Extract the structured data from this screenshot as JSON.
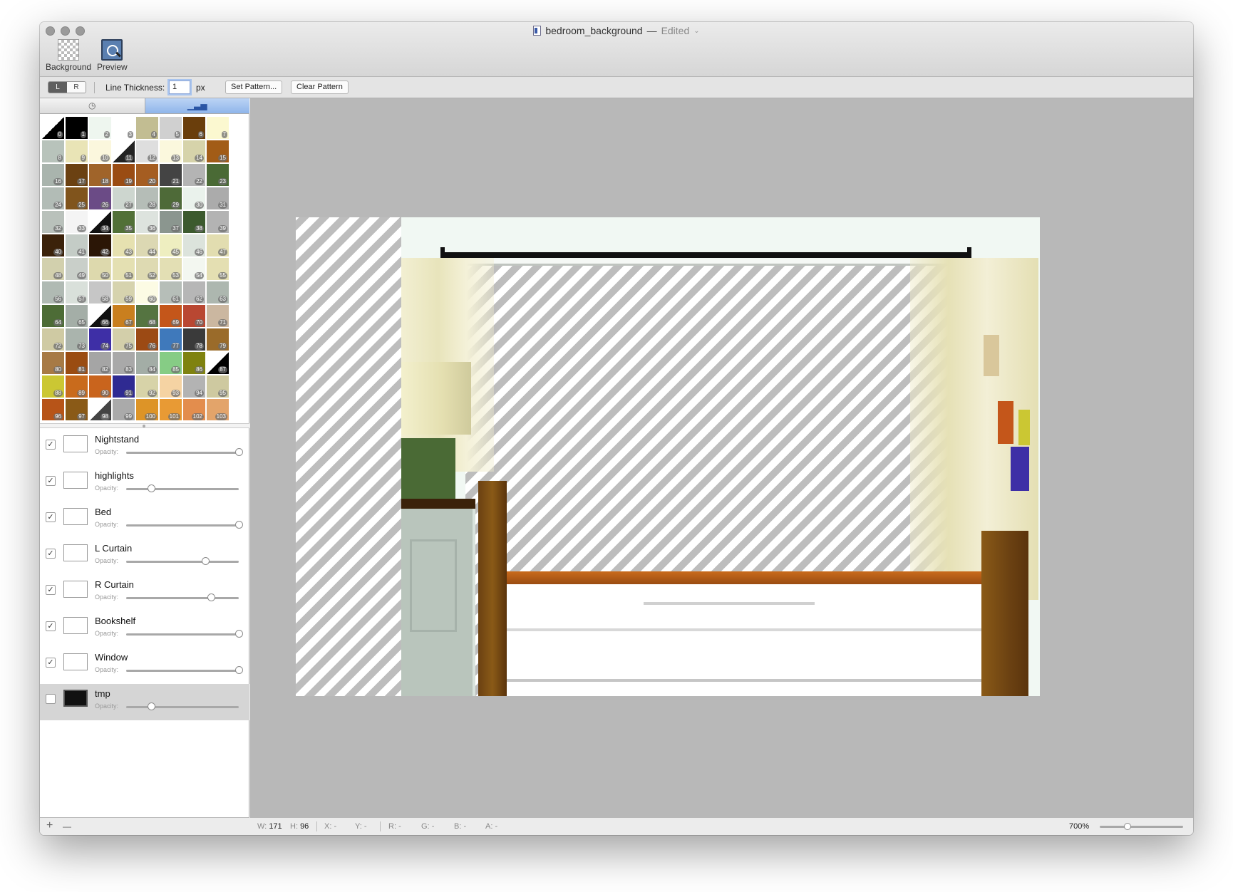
{
  "window": {
    "title": "bedroom_background",
    "title_separator": "—",
    "status": "Edited"
  },
  "toolbar": {
    "background_label": "Background",
    "preview_label": "Preview"
  },
  "options": {
    "left_button": "L",
    "right_button": "R",
    "line_thickness_label": "Line Thickness:",
    "line_thickness_value": "1",
    "line_thickness_unit": "px",
    "set_pattern_label": "Set Pattern...",
    "clear_pattern_label": "Clear Pattern"
  },
  "sidebar": {
    "tabs": [
      {
        "icon": "clock-icon",
        "label": "◷"
      },
      {
        "icon": "bar-chart-icon",
        "label": "▁▃▅"
      }
    ],
    "palette": [
      {
        "n": "0",
        "c": "split:#000000"
      },
      {
        "n": "1",
        "c": "#000000"
      },
      {
        "n": "2",
        "c": "#eef6ef"
      },
      {
        "n": "3",
        "c": "#ffffff"
      },
      {
        "n": "4",
        "c": "#c2bd92"
      },
      {
        "n": "5",
        "c": "#d0d0d0"
      },
      {
        "n": "6",
        "c": "#6a3e0c"
      },
      {
        "n": "7",
        "c": "#fbf8d0"
      },
      {
        "n": "8",
        "c": "#b8c3bb"
      },
      {
        "n": "9",
        "c": "#e9e4b6"
      },
      {
        "n": "10",
        "c": "#fbf7dd"
      },
      {
        "n": "11",
        "c": "split:#222222"
      },
      {
        "n": "12",
        "c": "#dedede"
      },
      {
        "n": "13",
        "c": "#fbf8dd"
      },
      {
        "n": "14",
        "c": "#d6d3aa"
      },
      {
        "n": "15",
        "c": "#a25c17"
      },
      {
        "n": "16",
        "c": "#a9b4ad"
      },
      {
        "n": "17",
        "c": "#6b4112"
      },
      {
        "n": "18",
        "c": "#a0642a"
      },
      {
        "n": "19",
        "c": "#9a4c13"
      },
      {
        "n": "20",
        "c": "#a55d21"
      },
      {
        "n": "21",
        "c": "#444444"
      },
      {
        "n": "22",
        "c": "#b4b4b4"
      },
      {
        "n": "23",
        "c": "#4a6a35"
      },
      {
        "n": "24",
        "c": "#b2bcb6"
      },
      {
        "n": "25",
        "c": "#80541c"
      },
      {
        "n": "26",
        "c": "#6b4b86"
      },
      {
        "n": "27",
        "c": "#cdd6cf"
      },
      {
        "n": "28",
        "c": "#b5bdb7"
      },
      {
        "n": "29",
        "c": "#4e6a38"
      },
      {
        "n": "30",
        "c": "#eaf2ec"
      },
      {
        "n": "31",
        "c": "#ababab"
      },
      {
        "n": "32",
        "c": "#b9c1bb"
      },
      {
        "n": "33",
        "c": "#f4f4f4"
      },
      {
        "n": "34",
        "c": "split:#111111"
      },
      {
        "n": "35",
        "c": "#517037"
      },
      {
        "n": "36",
        "c": "#dde3de"
      },
      {
        "n": "37",
        "c": "#8b968f"
      },
      {
        "n": "38",
        "c": "#3c5a2e"
      },
      {
        "n": "39",
        "c": "#b3b3b3"
      },
      {
        "n": "40",
        "c": "#3b220a"
      },
      {
        "n": "41",
        "c": "#c4ccc6"
      },
      {
        "n": "42",
        "c": "#2b1606"
      },
      {
        "n": "43",
        "c": "#e6e1b0"
      },
      {
        "n": "44",
        "c": "#dcd8b3"
      },
      {
        "n": "45",
        "c": "#eeeec0"
      },
      {
        "n": "46",
        "c": "#dce3dc"
      },
      {
        "n": "47",
        "c": "#e2ddb0"
      },
      {
        "n": "48",
        "c": "#d2d0ad"
      },
      {
        "n": "49",
        "c": "#c9cfc9"
      },
      {
        "n": "50",
        "c": "#ddd9ad"
      },
      {
        "n": "51",
        "c": "#e4e0b2"
      },
      {
        "n": "52",
        "c": "#dedab2"
      },
      {
        "n": "53",
        "c": "#e3dfb4"
      },
      {
        "n": "54",
        "c": "#f3f7f0"
      },
      {
        "n": "55",
        "c": "#e4dfb2"
      },
      {
        "n": "56",
        "c": "#b0bab3"
      },
      {
        "n": "57",
        "c": "#d9e0da"
      },
      {
        "n": "58",
        "c": "#c6c6c6"
      },
      {
        "n": "59",
        "c": "#d6d3ae"
      },
      {
        "n": "60",
        "c": "#fcfbe4"
      },
      {
        "n": "61",
        "c": "#b6beb8"
      },
      {
        "n": "62",
        "c": "#b6b6b6"
      },
      {
        "n": "63",
        "c": "#adb7af"
      },
      {
        "n": "64",
        "c": "#4d6c36"
      },
      {
        "n": "65",
        "c": "#a4aea7"
      },
      {
        "n": "66",
        "c": "split:#111111"
      },
      {
        "n": "67",
        "c": "#c97f1f"
      },
      {
        "n": "68",
        "c": "#557441"
      },
      {
        "n": "69",
        "c": "#c4561a"
      },
      {
        "n": "70",
        "c": "#b94732"
      },
      {
        "n": "71",
        "c": "#cbb7a0"
      },
      {
        "n": "72",
        "c": "#cfcaa3"
      },
      {
        "n": "73",
        "c": "#aab4ad"
      },
      {
        "n": "74",
        "c": "#3e2fa6"
      },
      {
        "n": "75",
        "c": "#d3cfaa"
      },
      {
        "n": "76",
        "c": "#9c4a14"
      },
      {
        "n": "77",
        "c": "#3f79bb"
      },
      {
        "n": "78",
        "c": "#3a3a3a"
      },
      {
        "n": "79",
        "c": "#9a6b2a"
      },
      {
        "n": "80",
        "c": "#a77a45"
      },
      {
        "n": "81",
        "c": "#9a4c12"
      },
      {
        "n": "82",
        "c": "#a5a5a5"
      },
      {
        "n": "83",
        "c": "#a9a9a9"
      },
      {
        "n": "84",
        "c": "#a3ada6"
      },
      {
        "n": "85",
        "c": "#86cc85"
      },
      {
        "n": "86",
        "c": "#7f820f"
      },
      {
        "n": "87",
        "c": "split:#000000"
      },
      {
        "n": "88",
        "c": "#cbc733"
      },
      {
        "n": "89",
        "c": "#c96b1c"
      },
      {
        "n": "90",
        "c": "#c9641d"
      },
      {
        "n": "91",
        "c": "#2f2a92"
      },
      {
        "n": "92",
        "c": "#d7d3a8"
      },
      {
        "n": "93",
        "c": "#f5d3a3"
      },
      {
        "n": "94",
        "c": "#b3b3b3"
      },
      {
        "n": "95",
        "c": "#cec9a0"
      },
      {
        "n": "96",
        "c": "#b75418"
      },
      {
        "n": "97",
        "c": "#8a5a17"
      },
      {
        "n": "98",
        "c": "split:#444444"
      },
      {
        "n": "99",
        "c": "#aaaaaa"
      },
      {
        "n": "100",
        "c": "#dd9427"
      },
      {
        "n": "101",
        "c": "#e89a34"
      },
      {
        "n": "102",
        "c": "#e38d4d"
      },
      {
        "n": "103",
        "c": "#e3a46a"
      }
    ],
    "layers": [
      {
        "name": "Nightstand",
        "visible": true,
        "opacity": 1.0,
        "opacity_label": "Opacity:"
      },
      {
        "name": "highlights",
        "visible": true,
        "opacity": 0.22,
        "opacity_label": "Opacity:"
      },
      {
        "name": "Bed",
        "visible": true,
        "opacity": 1.0,
        "opacity_label": "Opacity:"
      },
      {
        "name": "L Curtain",
        "visible": true,
        "opacity": 0.7,
        "opacity_label": "Opacity:"
      },
      {
        "name": "R Curtain",
        "visible": true,
        "opacity": 0.75,
        "opacity_label": "Opacity:"
      },
      {
        "name": "Bookshelf",
        "visible": true,
        "opacity": 1.0,
        "opacity_label": "Opacity:"
      },
      {
        "name": "Window",
        "visible": true,
        "opacity": 1.0,
        "opacity_label": "Opacity:"
      },
      {
        "name": "tmp",
        "visible": false,
        "opacity": 0.22,
        "opacity_label": "Opacity:",
        "selected": true
      }
    ],
    "add_label": "+",
    "remove_label": "—"
  },
  "status": {
    "w_label": "W:",
    "w_value": "171",
    "h_label": "H:",
    "h_value": "96",
    "x_label": "X:",
    "x_value": "-",
    "y_label": "Y:",
    "y_value": "-",
    "r_label": "R:",
    "r_value": "-",
    "g_label": "G:",
    "g_value": "-",
    "b_label": "B:",
    "b_value": "-",
    "a_label": "A:",
    "a_value": "-",
    "zoom_label": "700%",
    "zoom_fraction": 0.33
  },
  "icons": {
    "background": "checkerboard-icon",
    "preview": "magnifier-icon"
  }
}
